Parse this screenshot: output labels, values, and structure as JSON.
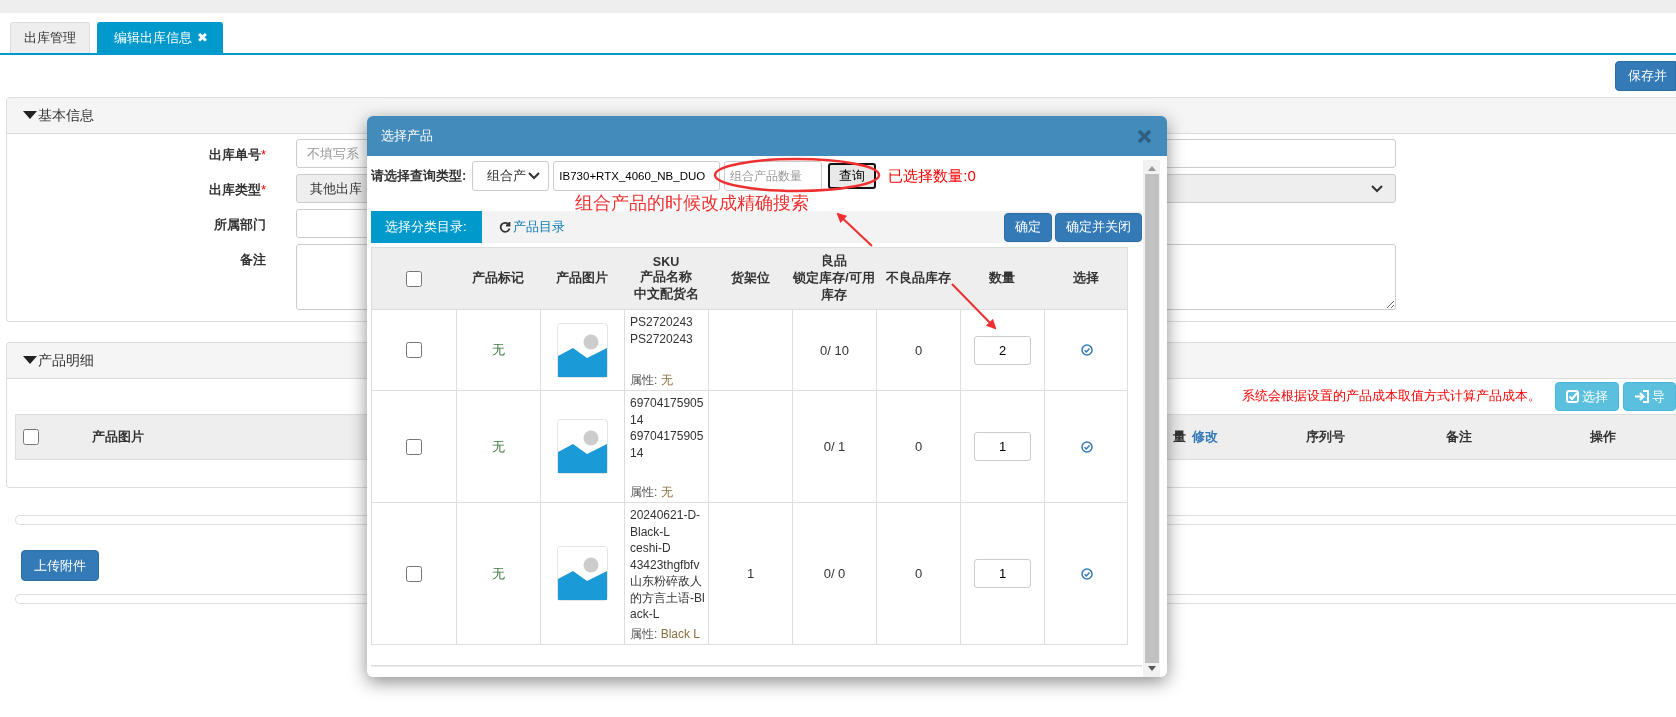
{
  "tabs": [
    {
      "label": "出库管理",
      "selected": false
    },
    {
      "label": "编辑出库信息",
      "selected": true,
      "close": "✖"
    }
  ],
  "toolbar": {
    "save_button": "保存并"
  },
  "basic_info": {
    "title": "基本信息",
    "expanded": true,
    "fields": [
      {
        "label": "出库单号",
        "required_mark": "*",
        "kind": "input",
        "placeholder": "不填写系"
      },
      {
        "label": "出库类型",
        "required_mark": "*",
        "kind": "select",
        "value": "其他出库",
        "disabled": true
      },
      {
        "label": "所属部门",
        "kind": "input"
      },
      {
        "label": "备注",
        "kind": "textarea"
      }
    ]
  },
  "product_details": {
    "title": "产品明细",
    "expanded": true,
    "note": "系统会根据设置的产品成本取值方式计算产品成本。",
    "buttons": [
      {
        "label": "选择"
      },
      {
        "label": "导"
      }
    ],
    "columns": [
      {
        "label": "产品图片"
      },
      {
        "label": "量",
        "link": "修改"
      },
      {
        "label": "序列号"
      },
      {
        "label": "备注"
      },
      {
        "label": "操作"
      }
    ],
    "select_all": false
  },
  "upload_button": "上传附件",
  "modal": {
    "title": "选择产品",
    "query_label": "请选择查询类型:",
    "query_type": "组合产",
    "keyword": "IB730+RTX_4060_NB_DUO",
    "qty_placeholder": "组合产品数量",
    "query_button": "查询",
    "selected_count": "已选择数量:0",
    "category_label": "选择分类目录:",
    "category_link": "产品目录",
    "buttons": [
      "确定",
      "确定并关闭"
    ],
    "select_all": false,
    "columns": [
      {
        "lines": [
          "产品标记"
        ]
      },
      {
        "lines": [
          "产品图片"
        ]
      },
      {
        "lines": [
          "SKU",
          "产品名称",
          "中文配货名"
        ]
      },
      {
        "lines": [
          "货架位"
        ]
      },
      {
        "lines": [
          "良品",
          "锁定库存/可用库存"
        ]
      },
      {
        "lines": [
          "不良品库存"
        ]
      },
      {
        "lines": [
          "数量"
        ]
      },
      {
        "lines": [
          "选择"
        ]
      }
    ],
    "rows": [
      {
        "checked": false,
        "mark": "无",
        "sku_lines": [
          "PS2720243",
          "PS2720243"
        ],
        "attr_label": "属性:",
        "attr_value": "无",
        "stock": "0/ 10",
        "defective": "0",
        "qty": "2"
      },
      {
        "checked": false,
        "mark": "无",
        "sku_lines": [
          "6970417590514",
          "6970417590514"
        ],
        "attr_label": "属性:",
        "attr_value": "无",
        "stock": "0/ 1",
        "defective": "0",
        "qty": "1"
      },
      {
        "checked": false,
        "mark": "无",
        "sku_lines": [
          "20240621-D-Black-L",
          "ceshi-D",
          "43423thgfbfv",
          "山东粉碎敌人的方言土语-Black-L"
        ],
        "attr_label": "属性:",
        "attr_value": "Black L",
        "shelf": "1",
        "stock": "0/ 0",
        "defective": "0",
        "qty": "1"
      }
    ]
  },
  "annotation": {
    "text": "组合产品的时候改成精确搜索"
  }
}
